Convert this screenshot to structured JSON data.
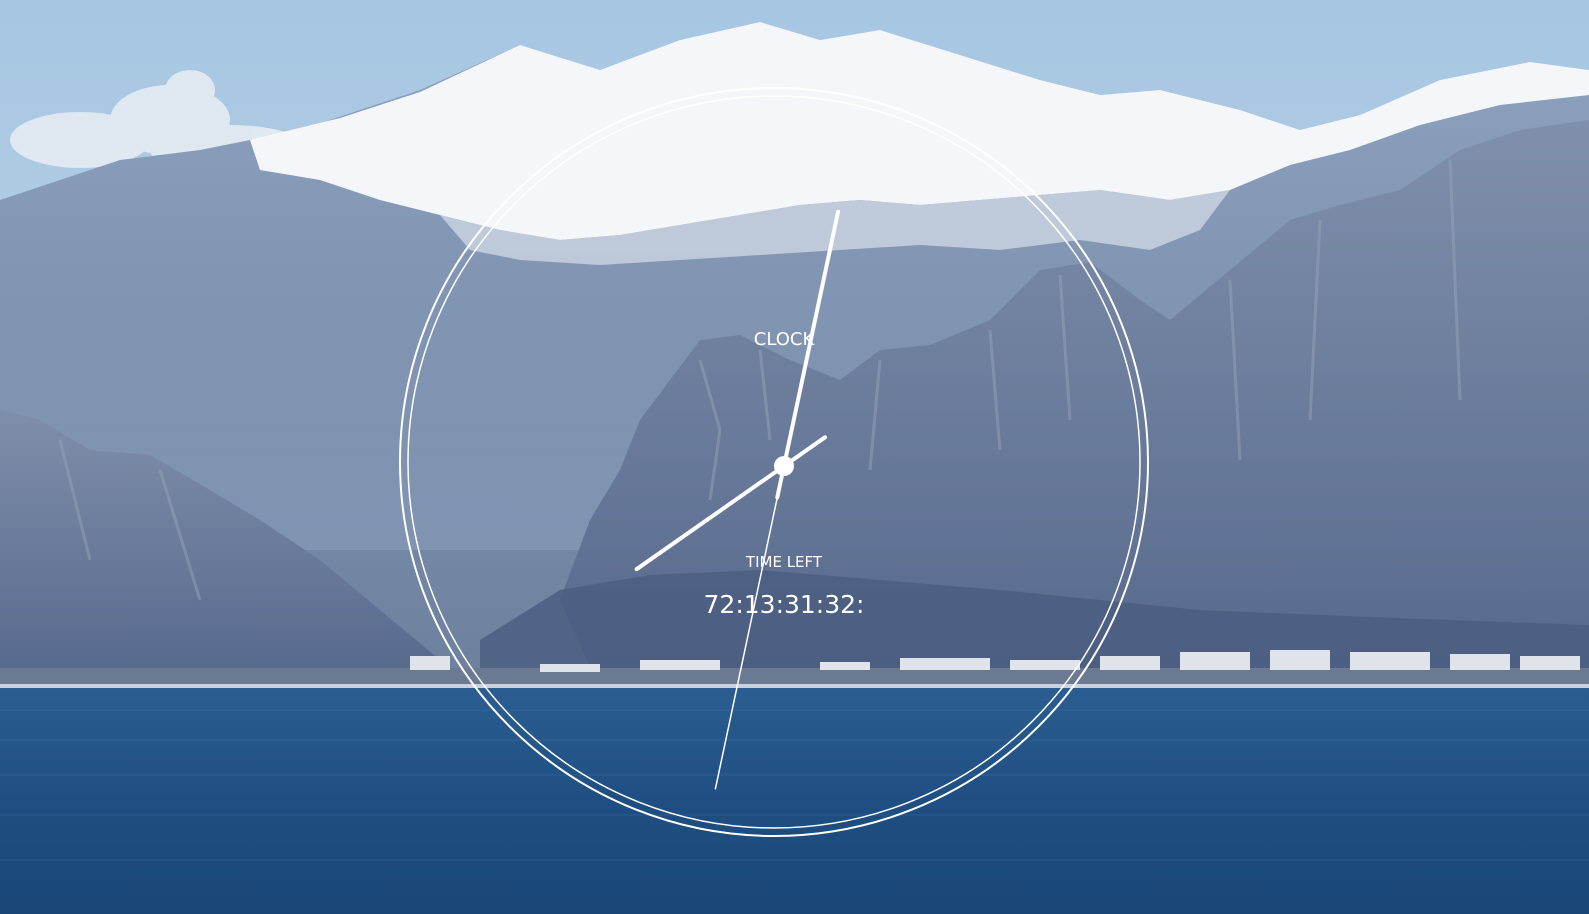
{
  "clock": {
    "label": "CLOCK",
    "hour_hand_time": "07:50",
    "minute_hand_minutes": 2,
    "second_hand_seconds": 32
  },
  "countdown": {
    "label": "TIME LEFT",
    "value": "72:13:31:32:"
  },
  "background": {
    "description_icon": "mountain-lake-photo",
    "colors": {
      "sky": "#a9c8e3",
      "snow": "#f3f5f8",
      "mountain_far": "#7f93b2",
      "mountain_near": "#6f7f9c",
      "sea": "#1f5388",
      "accent": "#ffffff"
    }
  }
}
